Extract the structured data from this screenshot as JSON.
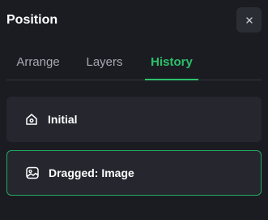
{
  "panel": {
    "title": "Position",
    "close_icon": "close-icon"
  },
  "tabs": [
    {
      "label": "Arrange",
      "active": false
    },
    {
      "label": "Layers",
      "active": false
    },
    {
      "label": "History",
      "active": true
    }
  ],
  "history": {
    "items": [
      {
        "label": "Initial",
        "icon": "home-icon",
        "selected": false
      },
      {
        "label": "Dragged: Image",
        "icon": "image-icon",
        "selected": true
      }
    ]
  },
  "colors": {
    "background": "#1b1c22",
    "accent": "#2cc16a",
    "item_background": "#25262e",
    "muted_text": "#a7aab3"
  }
}
